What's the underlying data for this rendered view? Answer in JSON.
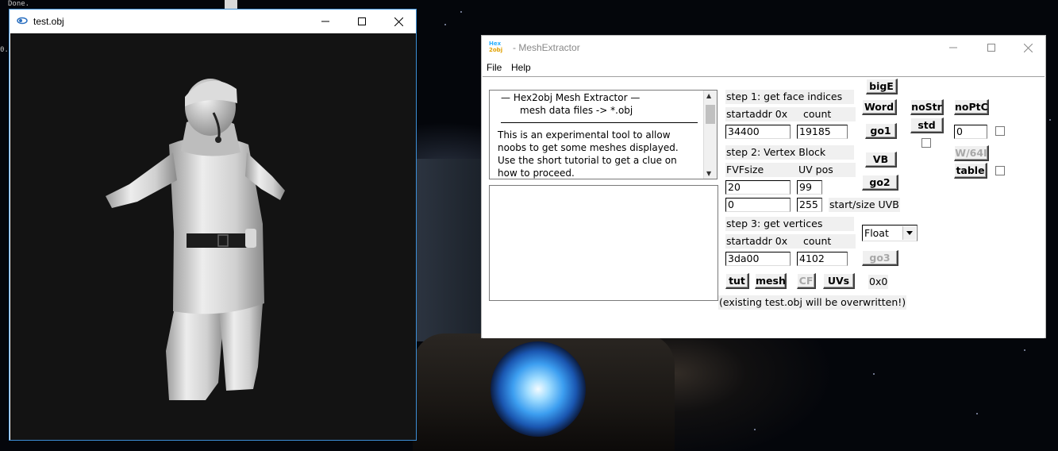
{
  "desktop": {
    "terminal_text": "Done.",
    "terminal_zero": "0."
  },
  "viewer": {
    "title": "test.obj",
    "controls": {
      "minimize": "—",
      "maximize": "☐",
      "close": "✕"
    }
  },
  "extractor": {
    "title": "- MeshExtractor",
    "logo_top": "Hex",
    "logo_bottom": "2obj",
    "menu": {
      "file": "File",
      "help": "Help"
    },
    "info": {
      "heading1": "—    Hex2obj Mesh Extractor    —",
      "heading2": "mesh data files -> *.obj",
      "body": [
        "This is an experimental tool to allow",
        "noobs to get some meshes displayed.",
        "Use the short tutorial to get a clue on",
        "how to proceed."
      ]
    },
    "step1": {
      "title": "step 1: get face indices",
      "startaddr_label": "startaddr 0x",
      "count_label": "count",
      "startaddr": "34400",
      "count": "19185"
    },
    "step2": {
      "title": "step 2: Vertex Block",
      "fvf_label": "FVFsize",
      "uvpos_label": "UV pos",
      "fvfsize": "20",
      "uvpos": "99",
      "uvb_start": "0",
      "uvb_size": "255",
      "uvb_label": "start/size UVB"
    },
    "step3": {
      "title": "step 3: get vertices",
      "startaddr_label": "startaddr 0x",
      "count_label": "count",
      "startaddr": "3da00",
      "count": "4102"
    },
    "buttons": {
      "bigE": "bigE",
      "word": "Word",
      "go1": "go1",
      "vb": "VB",
      "go2": "go2",
      "go3": "go3",
      "noStr": "noStr",
      "std": "std",
      "noPtC": "noPtC",
      "w64": "W/64I",
      "table": "table",
      "tut": "tut",
      "mesh": "mesh",
      "cf": "CF",
      "uvs": "UVs"
    },
    "format_select": "Float",
    "side_field": "0",
    "dims": "0x0",
    "warning": "(existing test.obj will be overwritten!)"
  }
}
